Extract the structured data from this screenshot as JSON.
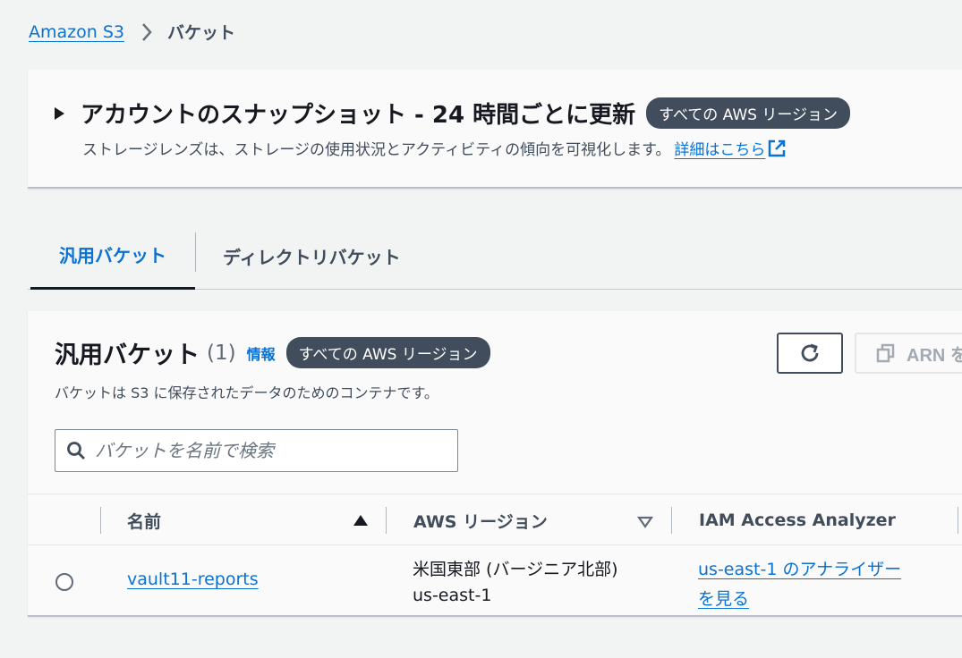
{
  "breadcrumb": {
    "root": "Amazon S3",
    "current": "バケット"
  },
  "snapshot": {
    "title": "アカウントのスナップショット - 24 時間ごとに更新",
    "badge": "すべての AWS リージョン",
    "description": "ストレージレンズは、ストレージの使用状況とアクティビティの傾向を可視化します。",
    "more_link": "詳細はこちら"
  },
  "tabs": [
    {
      "label": "汎用バケット",
      "active": true
    },
    {
      "label": "ディレクトリバケット",
      "active": false
    }
  ],
  "panel": {
    "title": "汎用バケット",
    "count": "(1)",
    "info": "情報",
    "badge": "すべての AWS リージョン",
    "description": "バケットは S3 に保存されたデータのためのコンテナです。",
    "arn_button": "ARN を"
  },
  "search": {
    "placeholder": "バケットを名前で検索"
  },
  "table": {
    "columns": [
      "名前",
      "AWS リージョン",
      "IAM Access Analyzer"
    ],
    "rows": [
      {
        "name": "vault11-reports",
        "region_name": "米国東部 (バージニア北部)",
        "region_code": "us-east-1",
        "analyzer_line1": "us-east-1 のアナライザー",
        "analyzer_line2": "を見る"
      }
    ]
  },
  "colors": {
    "link": "#0972d3",
    "badge_bg": "#414d5c",
    "background": "#f2f3f3"
  }
}
